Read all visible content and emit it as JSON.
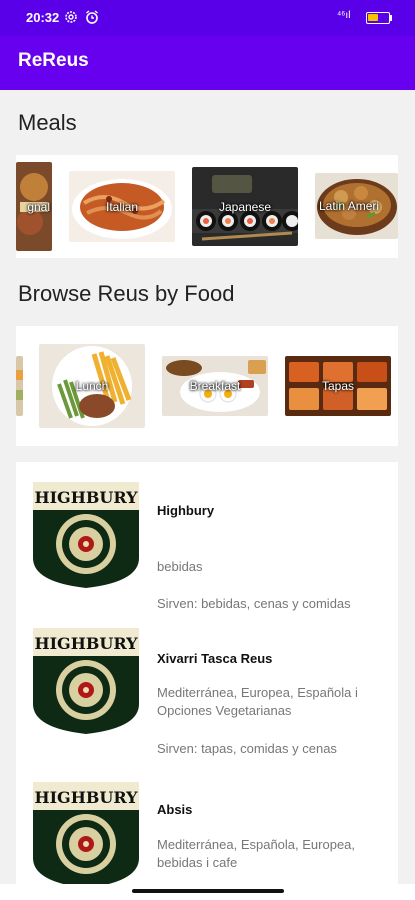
{
  "status_bar": {
    "time": "20:32",
    "icons": [
      "settings-icon",
      "alarm-icon"
    ],
    "signal_text": "⁴⁶ıl",
    "battery_level": 0.55,
    "battery_color": "#f5c300"
  },
  "app_bar": {
    "title": "ReReus",
    "color": "#6600ee"
  },
  "meals": {
    "title": "Meals",
    "items": [
      {
        "label": "gnal"
      },
      {
        "label": "Italian"
      },
      {
        "label": "Japanese"
      },
      {
        "label": "Latin Ameri"
      }
    ]
  },
  "browse": {
    "title": "Browse Reus by Food",
    "items": [
      {
        "label": ""
      },
      {
        "label": "Lunch"
      },
      {
        "label": "Breakfast"
      },
      {
        "label": "Tapas"
      }
    ]
  },
  "restaurants": [
    {
      "name": "Highbury",
      "cuisine": "bebidas",
      "serves": "Sirven: bebidas, cenas y comidas",
      "logo_text": "HIGHBURY"
    },
    {
      "name": "Xivarri Tasca Reus",
      "cuisine": "Mediterránea, Europea, Española i Opciones Vegetarianas",
      "serves": "Sirven: tapas, comidas y cenas",
      "logo_text": "HIGHBURY"
    },
    {
      "name": "Absis",
      "cuisine": "Mediterránea, Española, Europea, bebidas i cafe",
      "serves": "",
      "logo_text": "HIGHBURY"
    }
  ]
}
